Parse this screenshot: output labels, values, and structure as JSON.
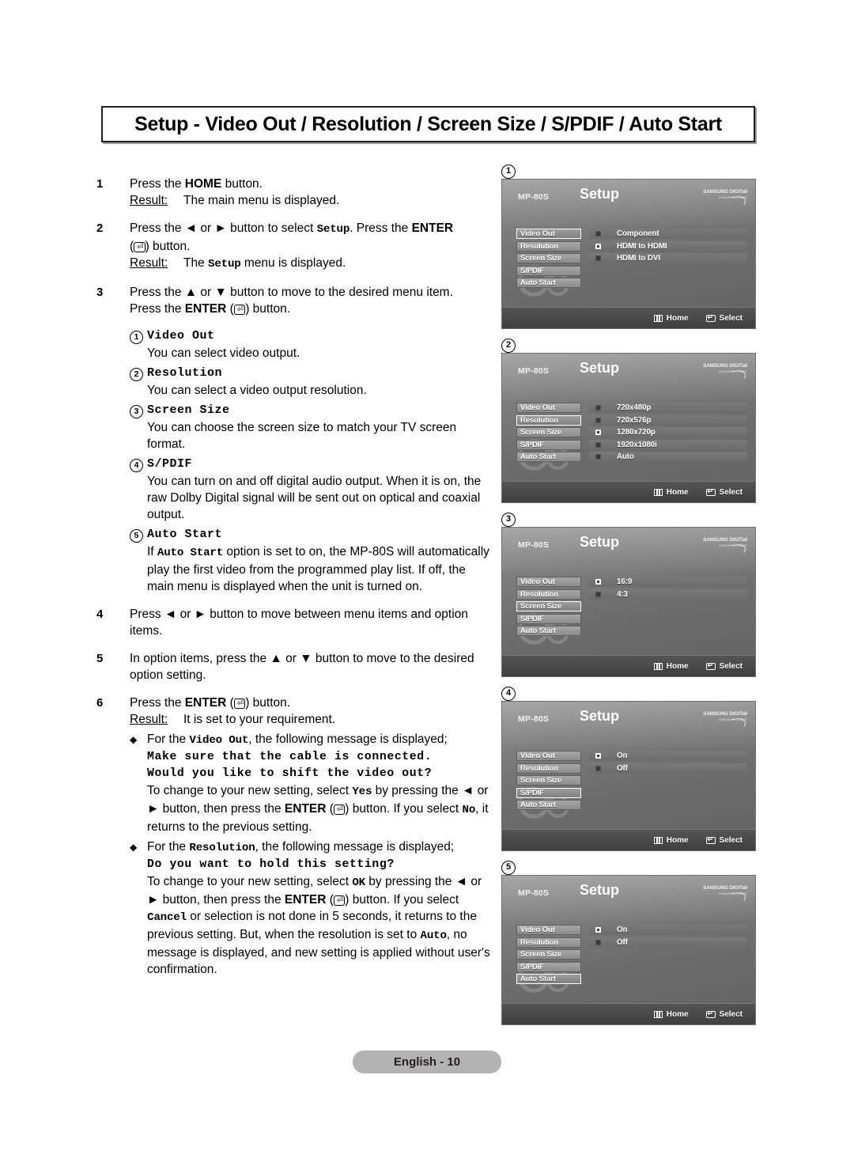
{
  "page": {
    "title": "Setup - Video Out / Resolution / Screen Size / S/PDIF / Auto Start",
    "footer_label": "English - 10"
  },
  "steps": [
    {
      "num": "1",
      "line1_a": "Press the ",
      "line1_bold": "HOME",
      "line1_b": " button.",
      "result_label": "Result:",
      "result_text": "The main menu is displayed."
    },
    {
      "num": "2",
      "line1_a": "Press the ◄ or ► button to select ",
      "line1_mono": "Setup",
      "line1_b": ". Press the ",
      "line1_bold2": "ENTER",
      "line2_b": ") button.",
      "result_label": "Result:",
      "result_a": "The ",
      "result_mono": "Setup",
      "result_b": " menu is displayed."
    },
    {
      "num": "3",
      "line1": "Press the ▲ or ▼ button to move to the desired menu item.",
      "line2_a": "Press the ",
      "line2_bold": "ENTER",
      "line2_b": ") button."
    }
  ],
  "subitems": [
    {
      "index": "1",
      "title": "Video Out",
      "desc": "You can select video output."
    },
    {
      "index": "2",
      "title": "Resolution",
      "desc": "You can select a video output resolution."
    },
    {
      "index": "3",
      "title": "Screen Size",
      "desc": "You can choose the screen size to match your TV screen format."
    },
    {
      "index": "4",
      "title": "S/PDIF",
      "desc": "You can turn on and off digital audio output. When it is on, the raw Dolby Digital signal will be sent out on optical and coaxial output."
    },
    {
      "index": "5",
      "title": "Auto Start",
      "desc_a": "If ",
      "desc_mono": "Auto Start",
      "desc_b": " option is set to on, the MP-80S will automatically play the first video from the programmed play list. If off, the main menu is displayed when the unit is turned on."
    }
  ],
  "steps2": [
    {
      "num": "4",
      "line1": "Press ◄ or ► button to move between menu items and option items."
    },
    {
      "num": "5",
      "line1": "In option items, press the ▲ or ▼ button to move to the desired option setting."
    },
    {
      "num": "6",
      "line1_a": "Press the ",
      "line1_bold": "ENTER",
      "line1_b": ") button.",
      "result_label": "Result:",
      "result_text": "It is set to your requirement."
    }
  ],
  "bullets": [
    {
      "mark": "◆",
      "lead_a": "For the ",
      "lead_mono": "Video Out",
      "lead_b": ", the following message is displayed;",
      "msg1": "Make sure that the cable is connected.",
      "msg2": "Would you like to shift the video out?",
      "tail_a": "To change to your new setting, select ",
      "tail_mono1": "Yes",
      "tail_b": " by pressing the ◄ or ► button, then press the ",
      "tail_bold": "ENTER",
      "tail_c": ") button. If you select ",
      "tail_mono2": "No",
      "tail_d": ", it returns to the previous setting."
    },
    {
      "mark": "◆",
      "lead_a": "For the ",
      "lead_mono": "Resolution",
      "lead_b": ", the following message is displayed;",
      "msg1": "Do you want to hold this setting?",
      "tail_a": "To change to your new setting, select ",
      "tail_mono1": "OK",
      "tail_b": " by pressing the ◄ or ► button, then press the ",
      "tail_bold": "ENTER",
      "tail_c": ") button. If you select ",
      "tail_mono2": "Cancel",
      "tail_d": " or selection is not done in 5 seconds, it returns to the previous setting. But, when the resolution is set to ",
      "tail_mono3": "Auto",
      "tail_e": ", no message is displayed, and new setting is applied without user's confirmation."
    }
  ],
  "panels": [
    {
      "index": "1",
      "model": "MP-80S",
      "screen_title": "Setup",
      "logo_line1": "SAMSUNG DIGITall",
      "logo_line2": "everyone's invited.",
      "menu": [
        {
          "label": "Video Out",
          "selected": true
        },
        {
          "label": "Resolution",
          "selected": false
        },
        {
          "label": "Screen Size",
          "selected": false
        },
        {
          "label": "S/PDIF",
          "selected": false
        },
        {
          "label": "Auto Start",
          "selected": false
        }
      ],
      "options": [
        {
          "label": "Component",
          "checked": false
        },
        {
          "label": "HDMI to HDMI",
          "checked": true
        },
        {
          "label": "HDMI to DVI",
          "checked": false
        }
      ],
      "foot_home": "Home",
      "foot_select": "Select"
    },
    {
      "index": "2",
      "model": "MP-80S",
      "screen_title": "Setup",
      "logo_line1": "SAMSUNG DIGITall",
      "logo_line2": "everyone's invited.",
      "menu": [
        {
          "label": "Video Out",
          "selected": false
        },
        {
          "label": "Resolution",
          "selected": true
        },
        {
          "label": "Screen Size",
          "selected": false
        },
        {
          "label": "S/PDIF",
          "selected": false
        },
        {
          "label": "Auto Start",
          "selected": false
        }
      ],
      "options": [
        {
          "label": "720x480p",
          "checked": false
        },
        {
          "label": "720x576p",
          "checked": false
        },
        {
          "label": "1280x720p",
          "checked": true
        },
        {
          "label": "1920x1080i",
          "checked": false
        },
        {
          "label": "Auto",
          "checked": false
        }
      ],
      "foot_home": "Home",
      "foot_select": "Select"
    },
    {
      "index": "3",
      "model": "MP-80S",
      "screen_title": "Setup",
      "logo_line1": "SAMSUNG DIGITall",
      "logo_line2": "everyone's invited.",
      "menu": [
        {
          "label": "Video Out",
          "selected": false
        },
        {
          "label": "Resolution",
          "selected": false
        },
        {
          "label": "Screen Size",
          "selected": true
        },
        {
          "label": "S/PDIF",
          "selected": false
        },
        {
          "label": "Auto Start",
          "selected": false
        }
      ],
      "options": [
        {
          "label": "16:9",
          "checked": true
        },
        {
          "label": "4:3",
          "checked": false
        }
      ],
      "foot_home": "Home",
      "foot_select": "Select"
    },
    {
      "index": "4",
      "model": "MP-80S",
      "screen_title": "Setup",
      "logo_line1": "SAMSUNG DIGITall",
      "logo_line2": "everyone's invited.",
      "menu": [
        {
          "label": "Video Out",
          "selected": false
        },
        {
          "label": "Resolution",
          "selected": false
        },
        {
          "label": "Screen Size",
          "selected": false
        },
        {
          "label": "S/PDIF",
          "selected": true
        },
        {
          "label": "Auto Start",
          "selected": false
        }
      ],
      "options": [
        {
          "label": "On",
          "checked": true
        },
        {
          "label": "Off",
          "checked": false
        }
      ],
      "foot_home": "Home",
      "foot_select": "Select"
    },
    {
      "index": "5",
      "model": "MP-80S",
      "screen_title": "Setup",
      "logo_line1": "SAMSUNG DIGITall",
      "logo_line2": "everyone's invited.",
      "menu": [
        {
          "label": "Video Out",
          "selected": false
        },
        {
          "label": "Resolution",
          "selected": false
        },
        {
          "label": "Screen Size",
          "selected": false
        },
        {
          "label": "S/PDIF",
          "selected": false
        },
        {
          "label": "Auto Start",
          "selected": true
        }
      ],
      "options": [
        {
          "label": "On",
          "checked": true
        },
        {
          "label": "Off",
          "checked": false
        }
      ],
      "foot_home": "Home",
      "foot_select": "Select"
    }
  ]
}
